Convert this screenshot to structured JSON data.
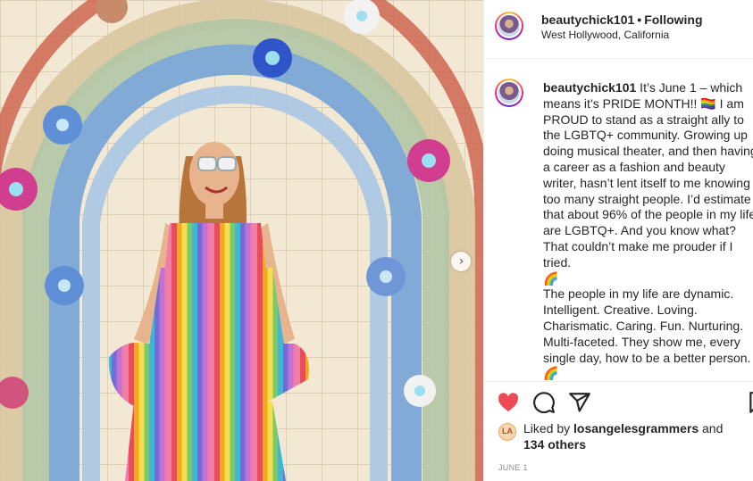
{
  "post": {
    "username": "beautychick101",
    "follow_status": "Following",
    "location": "West Hollywood, California"
  },
  "caption": {
    "username": "beautychick101",
    "text": " It’s June 1 – which means it’s PRIDE MONTH!! 🏳️‍🌈 I am PROUD to stand as a straight ally to the LGBTQ+ community. Growing up doing musical theater, and then having a career as a fashion and beauty writer, hasn’t lent itself to me knowing too many straight people. I’d estimate that about 96% of the people in my life are LGBTQ+. And you know what? That couldn’t make me prouder if I tried.\n🌈\nThe people in my life are dynamic. Intelligent. Creative. Loving. Charismatic. Caring. Fun. Nurturing. Multi-faceted. They show me, every single day, how to be a better person.\n🌈"
  },
  "likes": {
    "prefix": "Liked by ",
    "user": "losangelesgrammers",
    "middle": " and",
    "count_label": "134 others"
  },
  "date": "June 1",
  "icons": {
    "like": "heart-icon",
    "comment": "comment-icon",
    "share": "share-icon",
    "save": "bookmark-icon",
    "next": "chevron-right-icon"
  },
  "colors": {
    "like_red": "#ed4956",
    "text": "#262626",
    "muted": "#8e8e8e"
  }
}
